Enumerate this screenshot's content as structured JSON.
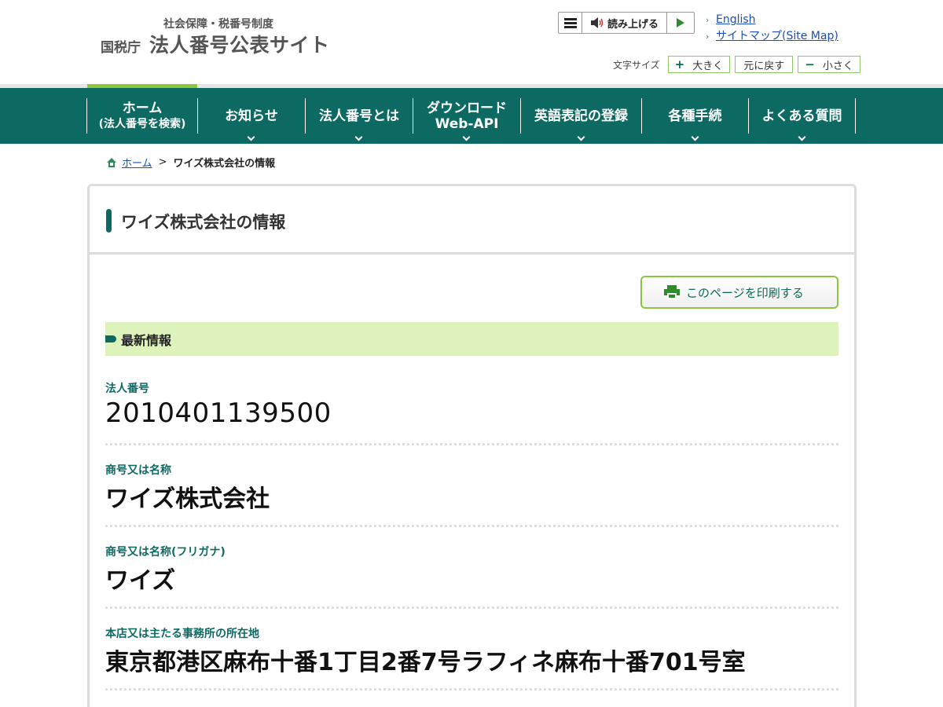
{
  "header": {
    "subtitle": "社会保障・税番号制度",
    "agency": "国税庁",
    "site_name": "法人番号公表サイト",
    "read_aloud": "読み上げる",
    "links": [
      "English",
      "サイトマップ(Site Map)"
    ],
    "font_size": {
      "label": "文字サイズ",
      "larger": "大きく",
      "reset": "元に戻す",
      "smaller": "小さく"
    }
  },
  "nav": {
    "items": [
      {
        "main": "ホーム",
        "small": "(法人番号を検索)"
      },
      {
        "main": "お知らせ"
      },
      {
        "main": "法人番号とは"
      },
      {
        "main": "ダウンロード",
        "small": "Web-API"
      },
      {
        "main": "英語表記の登録"
      },
      {
        "main": "各種手続"
      },
      {
        "main": "よくある質問"
      }
    ]
  },
  "breadcrumb": {
    "home": "ホーム",
    "separator": ">",
    "current": "ワイズ株式会社の情報"
  },
  "page": {
    "title": "ワイズ株式会社の情報",
    "print_label": "このページを印刷する",
    "section_title": "最新情報",
    "fields": [
      {
        "label": "法人番号",
        "value": "2010401139500"
      },
      {
        "label": "商号又は名称",
        "value": "ワイズ株式会社"
      },
      {
        "label": "商号又は名称(フリガナ)",
        "value": "ワイズ"
      },
      {
        "label": "本店又は主たる事務所の所在地",
        "value": "東京都港区麻布十番1丁目2番7号ラフィネ麻布十番701号室"
      }
    ]
  },
  "colors": {
    "nav_bg": "#0d6a63",
    "accent_green": "#8cc63f",
    "section_bg": "#def2bc",
    "link": "#1a4fb3"
  }
}
